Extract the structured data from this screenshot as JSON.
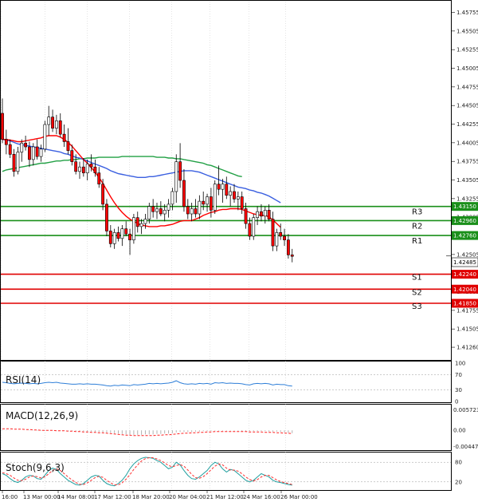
{
  "chart_data": {
    "type": "candlestick",
    "main": {
      "ylim": [
        1.411,
        1.459
      ],
      "y_ticks": [
        "1.45755",
        "1.45505",
        "1.45255",
        "1.45005",
        "1.44755",
        "1.44505",
        "1.44255",
        "1.44005",
        "1.43755",
        "1.43505",
        "1.43255",
        "1.43005",
        "1.42755",
        "1.42505",
        "1.42255",
        "1.42005",
        "1.41755",
        "1.41505",
        "1.41260"
      ],
      "candles": [
        {
          "o": 1.444,
          "h": 1.446,
          "l": 1.44,
          "c": 1.4405
        },
        {
          "o": 1.4405,
          "h": 1.4418,
          "l": 1.4385,
          "c": 1.4398
        },
        {
          "o": 1.4398,
          "h": 1.4405,
          "l": 1.438,
          "c": 1.4385
        },
        {
          "o": 1.4385,
          "h": 1.4392,
          "l": 1.4355,
          "c": 1.4362
        },
        {
          "o": 1.4362,
          "h": 1.4395,
          "l": 1.4358,
          "c": 1.4388
        },
        {
          "o": 1.4388,
          "h": 1.4405,
          "l": 1.4375,
          "c": 1.44
        },
        {
          "o": 1.44,
          "h": 1.441,
          "l": 1.439,
          "c": 1.4395
        },
        {
          "o": 1.4395,
          "h": 1.4402,
          "l": 1.4368,
          "c": 1.4378
        },
        {
          "o": 1.4378,
          "h": 1.44,
          "l": 1.437,
          "c": 1.4395
        },
        {
          "o": 1.4395,
          "h": 1.4405,
          "l": 1.4378,
          "c": 1.4382
        },
        {
          "o": 1.4382,
          "h": 1.4398,
          "l": 1.4375,
          "c": 1.4392
        },
        {
          "o": 1.4392,
          "h": 1.443,
          "l": 1.4388,
          "c": 1.4425
        },
        {
          "o": 1.4425,
          "h": 1.445,
          "l": 1.441,
          "c": 1.4435
        },
        {
          "o": 1.4435,
          "h": 1.4445,
          "l": 1.4415,
          "c": 1.442
        },
        {
          "o": 1.442,
          "h": 1.4438,
          "l": 1.4412,
          "c": 1.443
        },
        {
          "o": 1.443,
          "h": 1.444,
          "l": 1.4408,
          "c": 1.4412
        },
        {
          "o": 1.4412,
          "h": 1.4425,
          "l": 1.4395,
          "c": 1.4402
        },
        {
          "o": 1.4402,
          "h": 1.442,
          "l": 1.4385,
          "c": 1.439
        },
        {
          "o": 1.439,
          "h": 1.4398,
          "l": 1.437,
          "c": 1.4375
        },
        {
          "o": 1.4375,
          "h": 1.4385,
          "l": 1.4358,
          "c": 1.4362
        },
        {
          "o": 1.4362,
          "h": 1.4375,
          "l": 1.4352,
          "c": 1.4368
        },
        {
          "o": 1.4368,
          "h": 1.438,
          "l": 1.4355,
          "c": 1.436
        },
        {
          "o": 1.436,
          "h": 1.4378,
          "l": 1.435,
          "c": 1.4372
        },
        {
          "o": 1.4372,
          "h": 1.4385,
          "l": 1.4362,
          "c": 1.4368
        },
        {
          "o": 1.4368,
          "h": 1.4378,
          "l": 1.4355,
          "c": 1.436
        },
        {
          "o": 1.436,
          "h": 1.4368,
          "l": 1.434,
          "c": 1.4345
        },
        {
          "o": 1.4345,
          "h": 1.4352,
          "l": 1.431,
          "c": 1.4318
        },
        {
          "o": 1.4318,
          "h": 1.4325,
          "l": 1.4275,
          "c": 1.4282
        },
        {
          "o": 1.4282,
          "h": 1.429,
          "l": 1.426,
          "c": 1.4265
        },
        {
          "o": 1.4265,
          "h": 1.4285,
          "l": 1.4258,
          "c": 1.428
        },
        {
          "o": 1.428,
          "h": 1.4288,
          "l": 1.4268,
          "c": 1.4272
        },
        {
          "o": 1.4272,
          "h": 1.429,
          "l": 1.4262,
          "c": 1.4285
        },
        {
          "o": 1.4285,
          "h": 1.4295,
          "l": 1.4275,
          "c": 1.4278
        },
        {
          "o": 1.4278,
          "h": 1.4285,
          "l": 1.425,
          "c": 1.427
        },
        {
          "o": 1.427,
          "h": 1.4305,
          "l": 1.4265,
          "c": 1.43
        },
        {
          "o": 1.43,
          "h": 1.4308,
          "l": 1.428,
          "c": 1.4288
        },
        {
          "o": 1.4288,
          "h": 1.4298,
          "l": 1.4278,
          "c": 1.4292
        },
        {
          "o": 1.4292,
          "h": 1.4305,
          "l": 1.4285,
          "c": 1.4298
        },
        {
          "o": 1.4298,
          "h": 1.432,
          "l": 1.4292,
          "c": 1.4315
        },
        {
          "o": 1.4315,
          "h": 1.4325,
          "l": 1.43,
          "c": 1.4308
        },
        {
          "o": 1.4308,
          "h": 1.432,
          "l": 1.4298,
          "c": 1.4312
        },
        {
          "o": 1.4312,
          "h": 1.4322,
          "l": 1.4302,
          "c": 1.4305
        },
        {
          "o": 1.4305,
          "h": 1.4318,
          "l": 1.4295,
          "c": 1.431
        },
        {
          "o": 1.431,
          "h": 1.4325,
          "l": 1.43,
          "c": 1.4318
        },
        {
          "o": 1.4318,
          "h": 1.434,
          "l": 1.431,
          "c": 1.4335
        },
        {
          "o": 1.4335,
          "h": 1.4385,
          "l": 1.432,
          "c": 1.4375
        },
        {
          "o": 1.4375,
          "h": 1.44,
          "l": 1.434,
          "c": 1.435
        },
        {
          "o": 1.435,
          "h": 1.4365,
          "l": 1.4308,
          "c": 1.4315
        },
        {
          "o": 1.4315,
          "h": 1.4325,
          "l": 1.4298,
          "c": 1.4305
        },
        {
          "o": 1.4305,
          "h": 1.432,
          "l": 1.4295,
          "c": 1.4312
        },
        {
          "o": 1.4312,
          "h": 1.4325,
          "l": 1.43,
          "c": 1.4305
        },
        {
          "o": 1.4305,
          "h": 1.433,
          "l": 1.4298,
          "c": 1.4322
        },
        {
          "o": 1.4322,
          "h": 1.4335,
          "l": 1.431,
          "c": 1.4318
        },
        {
          "o": 1.4318,
          "h": 1.4332,
          "l": 1.4308,
          "c": 1.4328
        },
        {
          "o": 1.4328,
          "h": 1.434,
          "l": 1.43,
          "c": 1.431
        },
        {
          "o": 1.431,
          "h": 1.435,
          "l": 1.4305,
          "c": 1.4345
        },
        {
          "o": 1.4345,
          "h": 1.437,
          "l": 1.433,
          "c": 1.4338
        },
        {
          "o": 1.4338,
          "h": 1.4352,
          "l": 1.432,
          "c": 1.4345
        },
        {
          "o": 1.4345,
          "h": 1.4355,
          "l": 1.4325,
          "c": 1.433
        },
        {
          "o": 1.433,
          "h": 1.4342,
          "l": 1.4315,
          "c": 1.4335
        },
        {
          "o": 1.4335,
          "h": 1.4345,
          "l": 1.432,
          "c": 1.4325
        },
        {
          "o": 1.4325,
          "h": 1.4335,
          "l": 1.431,
          "c": 1.4328
        },
        {
          "o": 1.4328,
          "h": 1.4335,
          "l": 1.4305,
          "c": 1.4312
        },
        {
          "o": 1.4312,
          "h": 1.432,
          "l": 1.4285,
          "c": 1.4292
        },
        {
          "o": 1.4292,
          "h": 1.43,
          "l": 1.427,
          "c": 1.4275
        },
        {
          "o": 1.4275,
          "h": 1.4305,
          "l": 1.427,
          "c": 1.43
        },
        {
          "o": 1.43,
          "h": 1.4315,
          "l": 1.429,
          "c": 1.4308
        },
        {
          "o": 1.4308,
          "h": 1.4318,
          "l": 1.4295,
          "c": 1.4302
        },
        {
          "o": 1.4302,
          "h": 1.4315,
          "l": 1.4292,
          "c": 1.431
        },
        {
          "o": 1.431,
          "h": 1.4318,
          "l": 1.4295,
          "c": 1.4298
        },
        {
          "o": 1.4298,
          "h": 1.4308,
          "l": 1.4255,
          "c": 1.4262
        },
        {
          "o": 1.4262,
          "h": 1.4285,
          "l": 1.4255,
          "c": 1.428
        },
        {
          "o": 1.428,
          "h": 1.4292,
          "l": 1.427,
          "c": 1.4275
        },
        {
          "o": 1.4275,
          "h": 1.4285,
          "l": 1.4262,
          "c": 1.427
        },
        {
          "o": 1.427,
          "h": 1.4278,
          "l": 1.4245,
          "c": 1.425
        },
        {
          "o": 1.425,
          "h": 1.4258,
          "l": 1.424,
          "c": 1.4248
        }
      ],
      "ma_red": [
        1.4405,
        1.4405,
        1.4404,
        1.4403,
        1.4402,
        1.4402,
        1.4403,
        1.4404,
        1.4405,
        1.4406,
        1.4407,
        1.4409,
        1.441,
        1.441,
        1.441,
        1.4408,
        1.4405,
        1.4401,
        1.4396,
        1.439,
        1.4384,
        1.4378,
        1.4373,
        1.4367,
        1.4361,
        1.4354,
        1.4346,
        1.4337,
        1.4328,
        1.432,
        1.4313,
        1.4307,
        1.4302,
        1.4298,
        1.4295,
        1.4292,
        1.429,
        1.4289,
        1.4288,
        1.4288,
        1.4288,
        1.4289,
        1.4289,
        1.429,
        1.4291,
        1.4293,
        1.4295,
        1.4296,
        1.4296,
        1.4296,
        1.4298,
        1.43,
        1.4303,
        1.4305,
        1.4307,
        1.4308,
        1.431,
        1.4311,
        1.4311,
        1.4312,
        1.4312,
        1.4312,
        1.4311,
        1.4309,
        1.4307,
        1.4305,
        1.4304,
        1.4303,
        1.4303,
        1.4301,
        1.4297,
        1.4292,
        1.4287
      ],
      "ma_blue": [
        1.4405,
        1.4404,
        1.4403,
        1.4401,
        1.4399,
        1.4398,
        1.4397,
        1.4396,
        1.4395,
        1.4394,
        1.4393,
        1.4392,
        1.4391,
        1.439,
        1.4389,
        1.4388,
        1.4386,
        1.4385,
        1.4383,
        1.4381,
        1.438,
        1.4378,
        1.4376,
        1.4374,
        1.4372,
        1.437,
        1.4368,
        1.4366,
        1.4363,
        1.4361,
        1.4359,
        1.4358,
        1.4357,
        1.4356,
        1.4355,
        1.4354,
        1.4354,
        1.4354,
        1.4355,
        1.4355,
        1.4356,
        1.4357,
        1.4358,
        1.4359,
        1.436,
        1.4361,
        1.4362,
        1.4363,
        1.4363,
        1.4363,
        1.4362,
        1.4361,
        1.4359,
        1.4357,
        1.4355,
        1.4353,
        1.4351,
        1.4349,
        1.4347,
        1.4345,
        1.4343,
        1.4341,
        1.434,
        1.4339,
        1.4337,
        1.4336,
        1.4334,
        1.4333,
        1.4331,
        1.4329,
        1.4326,
        1.4323,
        1.432
      ],
      "ma_green": [
        1.4362,
        1.4364,
        1.4365,
        1.4366,
        1.4367,
        1.4368,
        1.4369,
        1.437,
        1.4371,
        1.4372,
        1.4373,
        1.4373,
        1.4374,
        1.4375,
        1.4376,
        1.4376,
        1.4377,
        1.4377,
        1.4378,
        1.4378,
        1.4379,
        1.4379,
        1.438,
        1.438,
        1.438,
        1.4381,
        1.4381,
        1.4381,
        1.4381,
        1.4381,
        1.4381,
        1.4382,
        1.4382,
        1.4382,
        1.4382,
        1.4382,
        1.4382,
        1.4382,
        1.4382,
        1.4382,
        1.4381,
        1.4381,
        1.4381,
        1.438,
        1.438,
        1.4379,
        1.4379,
        1.4378,
        1.4377,
        1.4376,
        1.4375,
        1.4374,
        1.4373,
        1.4371,
        1.437,
        1.4368,
        1.4366,
        1.4364,
        1.4362,
        1.436,
        1.4358,
        1.4356,
        1.4355
      ],
      "levels": [
        {
          "name": "R3",
          "value": 1.4315,
          "tag": "1.43150",
          "color": "#1a8f1a"
        },
        {
          "name": "R2",
          "value": 1.4296,
          "tag": "1.42960",
          "color": "#1a8f1a"
        },
        {
          "name": "R1",
          "value": 1.4276,
          "tag": "1.42760",
          "color": "#1a8f1a"
        },
        {
          "name": "S1",
          "value": 1.4224,
          "tag": "1.42240",
          "color": "#e00000"
        },
        {
          "name": "S2",
          "value": 1.4204,
          "tag": "1.42040",
          "color": "#e00000"
        },
        {
          "name": "S3",
          "value": 1.4185,
          "tag": "1.41850",
          "color": "#e00000"
        }
      ],
      "current": {
        "value": 1.42485,
        "tag": "1.42485"
      }
    },
    "rsi": {
      "label": "RSI(14)",
      "ylim": [
        0,
        100
      ],
      "y_ticks": [
        "100",
        "70",
        "30",
        "0"
      ],
      "levels": [
        70,
        30
      ],
      "values": [
        50,
        49,
        47,
        46,
        47,
        48,
        47,
        46,
        47,
        46,
        47,
        49,
        50,
        49,
        50,
        48,
        47,
        46,
        45,
        45,
        46,
        45,
        46,
        45,
        45,
        44,
        43,
        41,
        40,
        42,
        41,
        43,
        42,
        41,
        44,
        43,
        44,
        45,
        47,
        46,
        47,
        46,
        47,
        48,
        50,
        54,
        49,
        46,
        45,
        46,
        45,
        47,
        46,
        47,
        45,
        49,
        48,
        49,
        47,
        48,
        47,
        47,
        46,
        44,
        43,
        46,
        47,
        46,
        47,
        46,
        43,
        45,
        44,
        44,
        41,
        40
      ]
    },
    "macd": {
      "label": "MACD(12,26,9)",
      "ylim": [
        -0.00447,
        0.005723
      ],
      "y_ticks": [
        "0.005723",
        "0.00",
        "-0.00447"
      ],
      "histogram": [
        0.0001,
        0.0001,
        5e-05,
        0,
        0,
        0,
        0,
        -5e-05,
        -5e-05,
        -0.0001,
        -0.0001,
        -0.0001,
        -5e-05,
        -5e-05,
        -5e-05,
        -0.0001,
        -0.0001,
        -0.00015,
        -0.0002,
        -0.0002,
        -0.00025,
        -0.00025,
        -0.0003,
        -0.0003,
        -0.00035,
        -0.0004,
        -0.00045,
        -0.0005,
        -0.0006,
        -0.0007,
        -0.0008,
        -0.0009,
        -0.001,
        -0.0011,
        -0.0011,
        -0.0011,
        -0.0011,
        -0.001,
        -0.001,
        -0.001,
        -0.0009,
        -0.0009,
        -0.0008,
        -0.0008,
        -0.0007,
        -0.0005,
        -0.0004,
        -0.0004,
        -0.0004,
        -0.0004,
        -0.0003,
        -0.0003,
        -0.0002,
        -0.0002,
        -0.0002,
        -0.0001,
        -0.0001,
        -0.0001,
        -0.0001,
        -0.0001,
        -0.0001,
        -0.0001,
        -0.0002,
        -0.0002,
        -0.0002,
        -0.0002,
        -0.0002,
        -0.0002,
        -0.0002,
        -0.0003,
        -0.0003,
        -0.0003,
        -0.0004,
        -0.0005,
        -0.0006,
        -0.0007
      ],
      "signal": [
        0.0004,
        0.0004,
        0.0004,
        0.0003,
        0.0003,
        0.0003,
        0.0002,
        0.0002,
        0.0001,
        0.0001,
        0.0,
        0.0,
        0.0,
        0.0,
        -0.0001,
        -0.0001,
        -0.0001,
        -0.0002,
        -0.0002,
        -0.0003,
        -0.0003,
        -0.0004,
        -0.0004,
        -0.0005,
        -0.0005,
        -0.0006,
        -0.0006,
        -0.0007,
        -0.0008,
        -0.0009,
        -0.001,
        -0.0011,
        -0.0012,
        -0.0012,
        -0.0013,
        -0.0013,
        -0.0013,
        -0.0013,
        -0.0013,
        -0.0013,
        -0.0012,
        -0.0012,
        -0.0011,
        -0.0011,
        -0.001,
        -0.0009,
        -0.0008,
        -0.0007,
        -0.0007,
        -0.0006,
        -0.0006,
        -0.0005,
        -0.0005,
        -0.0004,
        -0.0004,
        -0.0003,
        -0.0003,
        -0.0003,
        -0.0003,
        -0.0003,
        -0.0003,
        -0.0003,
        -0.0003,
        -0.0003,
        -0.0004,
        -0.0004,
        -0.0004,
        -0.0004,
        -0.0005,
        -0.0005,
        -0.0005,
        -0.0006,
        -0.0006,
        -0.0007,
        -0.0007,
        -0.0008
      ]
    },
    "stoch": {
      "label": "Stoch(9,6,3)",
      "ylim": [
        0,
        100
      ],
      "y_ticks": [
        "80",
        "20"
      ],
      "levels": [
        80,
        20
      ],
      "main": [
        45,
        40,
        30,
        22,
        18,
        25,
        35,
        40,
        38,
        30,
        28,
        40,
        55,
        62,
        58,
        45,
        35,
        25,
        18,
        12,
        10,
        15,
        25,
        35,
        40,
        38,
        25,
        15,
        10,
        8,
        15,
        25,
        40,
        60,
        75,
        85,
        92,
        95,
        94,
        92,
        85,
        80,
        70,
        60,
        65,
        80,
        72,
        55,
        40,
        30,
        28,
        35,
        45,
        55,
        70,
        80,
        75,
        60,
        50,
        58,
        55,
        45,
        35,
        25,
        20,
        25,
        35,
        45,
        40,
        35,
        25,
        20,
        18,
        15,
        12,
        10
      ],
      "signal": [
        48,
        45,
        40,
        32,
        25,
        24,
        28,
        35,
        38,
        36,
        32,
        35,
        45,
        55,
        60,
        55,
        45,
        35,
        26,
        18,
        13,
        12,
        17,
        25,
        33,
        37,
        34,
        25,
        17,
        11,
        11,
        17,
        28,
        42,
        58,
        72,
        84,
        91,
        94,
        94,
        90,
        85,
        78,
        70,
        66,
        70,
        73,
        68,
        56,
        43,
        33,
        31,
        36,
        45,
        57,
        68,
        75,
        72,
        62,
        56,
        56,
        53,
        45,
        35,
        27,
        23,
        27,
        35,
        40,
        40,
        33,
        26,
        21,
        18,
        15,
        12
      ]
    },
    "x_ticks": [
      "16:00",
      "13 Mar 00:00",
      "14 Mar 08:00",
      "17 Mar 12:00",
      "18 Mar 20:00",
      "20 Mar 04:00",
      "21 Mar 12:00",
      "24 Mar 16:00",
      "26 Mar 00:00"
    ]
  },
  "colors": {
    "bull_body": "#ffffff",
    "bear_body": "#ff0000",
    "candle_outline": "#000000",
    "ma_red": "#ff0000",
    "ma_blue": "#3a5fe0",
    "ma_green": "#22a045",
    "resistance": "#1a8f1a",
    "support": "#e00000",
    "rsi_line": "#2f7fd8",
    "macd_hist": "#b0b0b0",
    "macd_signal": "#ff2020",
    "stoch_main": "#20a0a0",
    "stoch_signal": "#ff3030",
    "grid": "#bbbbbb",
    "frame": "#000000"
  }
}
